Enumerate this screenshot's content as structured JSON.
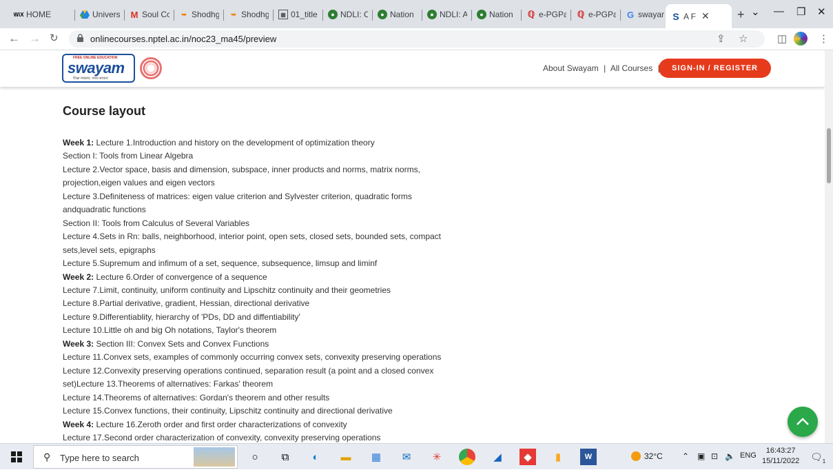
{
  "browser": {
    "tabs": [
      {
        "label": "HOME",
        "icon": "wix-icon"
      },
      {
        "label": "Univers",
        "icon": "drive-icon"
      },
      {
        "label": "Soul Cc",
        "icon": "gmail-icon"
      },
      {
        "label": "Shodhg",
        "icon": "shodhganga-icon"
      },
      {
        "label": "Shodhg",
        "icon": "shodhganga-icon"
      },
      {
        "label": "01_title",
        "icon": "document-icon"
      },
      {
        "label": "NDLI: C",
        "icon": "ndli-icon"
      },
      {
        "label": "Nation",
        "icon": "ndli-icon"
      },
      {
        "label": "NDLI: A",
        "icon": "ndli-icon"
      },
      {
        "label": "Nation",
        "icon": "ndli-icon"
      },
      {
        "label": "e-PGPa",
        "icon": "epg-icon"
      },
      {
        "label": "e-PGPa",
        "icon": "epg-icon"
      },
      {
        "label": "swayar",
        "icon": "google-icon"
      }
    ],
    "active_tab": {
      "label": "A F",
      "icon": "swayam-s-icon"
    },
    "new_tab": "+",
    "url": "onlinecourses.nptel.ac.in/noc23_ma45/preview"
  },
  "site": {
    "logo_text": "swayam",
    "logo_top": "FREE ONLINE EDUCATION",
    "logo_sub": "शिक्षा मंत्रालय, भारत सरकार",
    "about_link": "About Swayam",
    "sep1": "|",
    "courses_link": "All Courses",
    "sep2": "|",
    "signin_label": "SIGN-IN / REGISTER",
    "accent_color": "#e53b1c"
  },
  "course": {
    "title": "Course layout",
    "lines": [
      {
        "bold": "Week 1:",
        "text": " Lecture 1.Introduction and history on the development of optimization theory"
      },
      {
        "bold": "",
        "text": "Section I: Tools from Linear Algebra"
      },
      {
        "bold": "",
        "text": "Lecture 2.Vector space, basis and dimension, subspace, inner products and norms, matrix norms,"
      },
      {
        "bold": "",
        "text": "projection,eigen values and eigen vectors"
      },
      {
        "bold": "",
        "text": "Lecture 3.Definiteness of matrices: eigen value criterion and Sylvester criterion, quadratic forms"
      },
      {
        "bold": "",
        "text": "andquadratic functions"
      },
      {
        "bold": "",
        "text": "Section II: Tools from Calculus of Several Variables"
      },
      {
        "bold": "",
        "text": "Lecture 4.Sets in Rn: balls, neighborhood, interior point, open sets, closed sets, bounded sets, compact"
      },
      {
        "bold": "",
        "text": "sets,level sets, epigraphs"
      },
      {
        "bold": "",
        "text": "Lecture 5.Supremum and infimum of a set, sequence, subsequence, limsup and liminf"
      },
      {
        "bold": "Week 2:",
        "text": " Lecture 6.Order of convergence of a sequence"
      },
      {
        "bold": "",
        "text": "Lecture 7.Limit, continuity, uniform continuity and Lipschitz continuity and their geometries"
      },
      {
        "bold": "",
        "text": "Lecture 8.Partial derivative, gradient, Hessian, directional derivative"
      },
      {
        "bold": "",
        "text": "Lecture 9.Differentiablity, hierarchy of 'PDs, DD and diffentiability'"
      },
      {
        "bold": "",
        "text": "Lecture 10.Little oh and big Oh notations, Taylor's theorem"
      },
      {
        "bold": "Week 3:",
        "text": " Section III: Convex Sets and Convex Functions"
      },
      {
        "bold": "",
        "text": "Lecture 11.Convex sets, examples of commonly occurring convex sets, convexity preserving operations"
      },
      {
        "bold": "",
        "text": "Lecture 12.Convexity preserving operations continued, separation result (a point and a closed convex"
      },
      {
        "bold": "",
        "text": "set)Lecture 13.Theorems of alternatives: Farkas' theorem"
      },
      {
        "bold": "",
        "text": "Lecture 14.Theorems of alternatives: Gordan's theorem and other results"
      },
      {
        "bold": "",
        "text": "Lecture 15.Convex functions, their continuity, Lipschitz continuity and directional derivative"
      },
      {
        "bold": "Week 4:",
        "text": " Lecture 16.Zeroth order and first order characterizations of convexity"
      },
      {
        "bold": "",
        "text": "Lecture 17.Second order characterization of convexity, convexity preserving operations"
      }
    ]
  },
  "taskbar": {
    "search_placeholder": "Type here to search",
    "weather": "32°C",
    "language": "ENG",
    "time": "16:43:27",
    "date": "15/11/2022",
    "notification_count": "1"
  }
}
